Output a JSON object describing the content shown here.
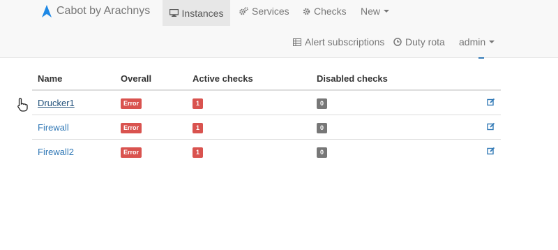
{
  "navbar": {
    "brand": "Cabot by Arachnys",
    "items": [
      {
        "label": "Instances",
        "icon": "monitor-icon",
        "active": true
      },
      {
        "label": "Services",
        "icon": "cogs-icon"
      },
      {
        "label": "Checks",
        "icon": "gear-icon"
      },
      {
        "label": "New",
        "dropdown": true
      }
    ],
    "secondary": [
      {
        "label": "Alert subscriptions",
        "icon": "list-icon"
      },
      {
        "label": "Duty rota",
        "icon": "clock-icon"
      },
      {
        "label": "admin",
        "dropdown": true
      }
    ]
  },
  "table": {
    "columns": [
      "Name",
      "Overall",
      "Active checks",
      "Disabled checks"
    ],
    "rows": [
      {
        "name": "Drucker1",
        "overall": "Error",
        "active_checks": "1",
        "disabled_checks": "0"
      },
      {
        "name": "Firewall",
        "overall": "Error",
        "active_checks": "1",
        "disabled_checks": "0"
      },
      {
        "name": "Firewall2",
        "overall": "Error",
        "active_checks": "1",
        "disabled_checks": "0"
      }
    ]
  },
  "colors": {
    "navbar_bg": "#f8f8f8",
    "active_tab_bg": "#e7e7e7",
    "link": "#337ab7",
    "danger": "#d9534f",
    "default": "#777777",
    "brand_icon": "#1e88e5"
  }
}
